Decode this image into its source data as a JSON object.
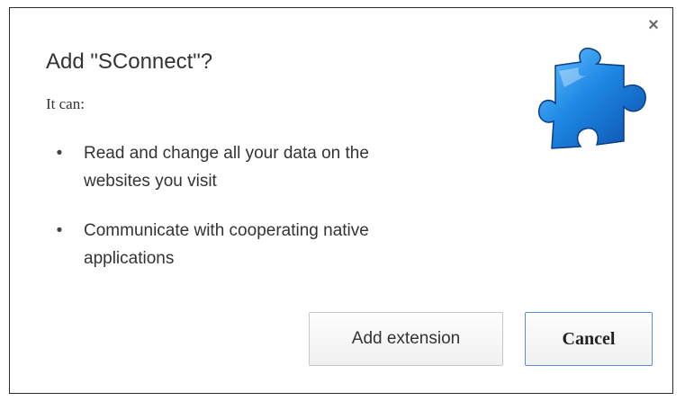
{
  "dialog": {
    "title": "Add \"SConnect\"?",
    "intro": "It can:",
    "permissions": [
      {
        "line1": "Read and change all your data on the",
        "line2": "websites you visit"
      },
      {
        "line1": "Communicate with cooperating native",
        "line2": "applications"
      }
    ],
    "bullet": "•",
    "close_glyph": "×",
    "icon": "puzzle-piece-icon",
    "buttons": {
      "add": "Add extension",
      "cancel": "Cancel"
    },
    "colors": {
      "icon_primary": "#1e88e5",
      "focus_border": "#5a8fd6"
    }
  }
}
